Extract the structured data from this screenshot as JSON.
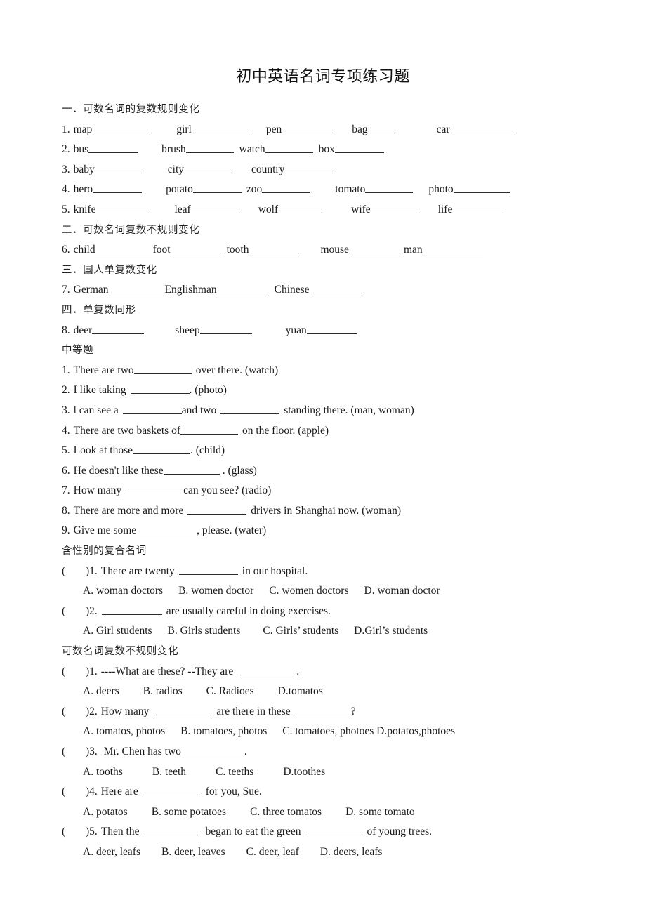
{
  "document": {
    "title": "初中英语名词专项练习题"
  },
  "sections": {
    "s1_heading": "一．可数名词的复数规则变化",
    "s2_heading": "二．可数名词复数不规则变化",
    "s3_heading": "三．国人单复数变化",
    "s4_heading": "四．单复数同形",
    "s5_heading": "中等题",
    "s6_heading": "含性别的复合名词",
    "s7_heading": "可数名词复数不规则变化"
  },
  "plural_drills": [
    {
      "num": "1.",
      "words": [
        "map",
        "girl",
        "pen",
        "bag",
        "car"
      ]
    },
    {
      "num": "2.",
      "words": [
        "bus",
        "brush",
        "watch",
        "box"
      ]
    },
    {
      "num": "3.",
      "words": [
        "baby",
        "city",
        "country"
      ]
    },
    {
      "num": "4.",
      "words": [
        "hero",
        "potato",
        "zoo",
        "tomato",
        "photo"
      ]
    },
    {
      "num": "5.",
      "words": [
        "knife",
        "leaf",
        "wolf",
        "wife",
        "life"
      ]
    },
    {
      "num": "6.",
      "words": [
        "child",
        "foot",
        "tooth",
        "mouse",
        "man"
      ]
    },
    {
      "num": "7.",
      "words": [
        "German",
        "Englishman",
        "Chinese"
      ]
    },
    {
      "num": "8.",
      "words": [
        "deer",
        "sheep",
        "yuan"
      ]
    }
  ],
  "fill_in_questions": [
    {
      "num": "1.",
      "pre": "There are two",
      "mid": "",
      "post": "over there. (watch)"
    },
    {
      "num": "2.",
      "pre": "I like taking",
      "mid": "",
      "post": ". (photo)"
    },
    {
      "num": "3.",
      "pre": "l can see a",
      "mid": "and two",
      "post": "standing there. (man, woman)"
    },
    {
      "num": "4.",
      "pre": "There are two baskets of",
      "mid": "",
      "post": "on the floor. (apple)"
    },
    {
      "num": "5.",
      "pre": "Look at those",
      "mid": "",
      "post": ". (child)"
    },
    {
      "num": "6.",
      "pre": "He doesn't like these",
      "mid": "",
      "post": ". (glass)"
    },
    {
      "num": "7.",
      "pre": "How many",
      "mid": "",
      "post": "can you see? (radio)"
    },
    {
      "num": "8.",
      "pre": "There are more and more",
      "mid": "",
      "post": "drivers in Shanghai now. (woman)"
    },
    {
      "num": "9.",
      "pre": "Give me some",
      "mid": "",
      "post": ", please. (water)"
    }
  ],
  "mc_gender": [
    {
      "num": ")1.",
      "pre": "There are twenty",
      "post": "in our hospital.",
      "options": [
        "A. woman doctors",
        "B. women doctor",
        "C. women doctors",
        "D. woman doctor"
      ]
    },
    {
      "num": ")2.",
      "pre": "",
      "post": "are usually careful in doing exercises.",
      "options": [
        "A. Girl students",
        "B. Girls students",
        "C. Girls’  students",
        "D.Girl’s students"
      ]
    }
  ],
  "mc_irregular": [
    {
      "num": ")1.",
      "pre": "----What are these?    --They are",
      "post": ".",
      "options": [
        "A. deers",
        "B. radios",
        "C. Radioes",
        "D.tomatos"
      ]
    },
    {
      "num": ")2.",
      "pre": "How many",
      "mid": "are there in these",
      "post": "?",
      "options": [
        "A. tomatos, photos",
        "B. tomatoes, photos",
        "C. tomatoes, photoes D.potatos,photoes"
      ]
    },
    {
      "num": ")3.",
      "pre": "  Mr. Chen has two",
      "post": ".",
      "options": [
        "A. tooths",
        "B. teeth",
        "C. teeths",
        "D.toothes"
      ]
    },
    {
      "num": ")4.",
      "pre": "Here are",
      "post": "for you, Sue.",
      "options": [
        "A. potatos",
        "B. some potatoes",
        "C. three tomatos",
        "D. some tomato"
      ]
    },
    {
      "num": ")5.",
      "pre": "Then the",
      "mid": "began to eat the green",
      "post": "of young trees.",
      "options": [
        "A. deer, leafs",
        "B. deer, leaves",
        "C. deer, leaf",
        "D. deers, leafs"
      ]
    }
  ],
  "paren_open": "("
}
